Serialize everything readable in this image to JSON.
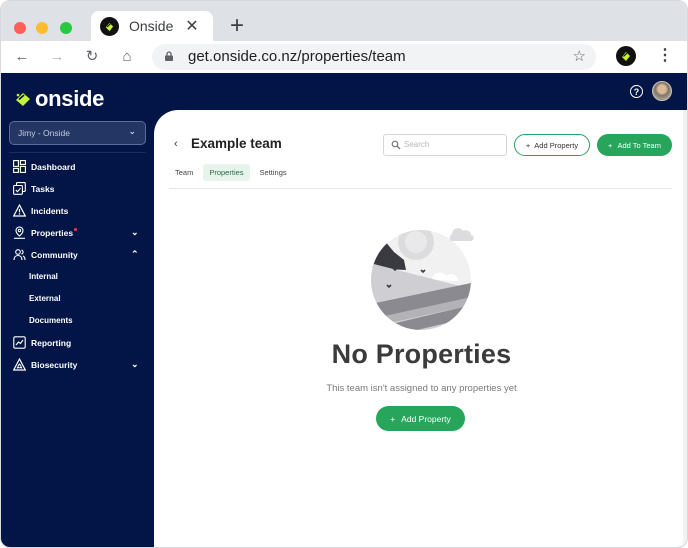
{
  "browser": {
    "tab_title": "Onside",
    "url": "get.onside.co.nz/properties/team",
    "new_tab_symbol": "+",
    "close_symbol": "✕"
  },
  "app": {
    "brand": "onside",
    "help_symbol": "?",
    "org_selector": "Jimy - Onside",
    "sidebar": {
      "items": [
        {
          "label": "Dashboard",
          "icon": "dashboard-icon"
        },
        {
          "label": "Tasks",
          "icon": "tasks-icon"
        },
        {
          "label": "Incidents",
          "icon": "warning-icon"
        },
        {
          "label": "Properties",
          "icon": "location-pin-icon",
          "badge": true,
          "expanded": false
        },
        {
          "label": "Community",
          "icon": "people-icon",
          "expanded": true
        },
        {
          "label": "Internal",
          "sub": true
        },
        {
          "label": "External",
          "sub": true
        },
        {
          "label": "Documents",
          "sub": true
        },
        {
          "label": "Reporting",
          "icon": "chart-icon"
        },
        {
          "label": "Biosecurity",
          "icon": "biohazard-icon",
          "expanded": false
        }
      ]
    },
    "main": {
      "back_symbol": "‹",
      "title": "Example team",
      "search_placeholder": "Search",
      "add_property_label": "Add Property",
      "add_to_team_label": "Add To Team",
      "tabs": [
        {
          "label": "Team",
          "active": false
        },
        {
          "label": "Properties",
          "active": true
        },
        {
          "label": "Settings",
          "active": false
        }
      ],
      "empty_state": {
        "title": "No Properties",
        "subtitle": "This team isn't assigned to any properties yet",
        "button_label": "Add Property"
      }
    },
    "colors": {
      "sidebar_bg": "#031546",
      "accent_green": "#27a55b",
      "brand_lime": "#c6f432"
    }
  }
}
